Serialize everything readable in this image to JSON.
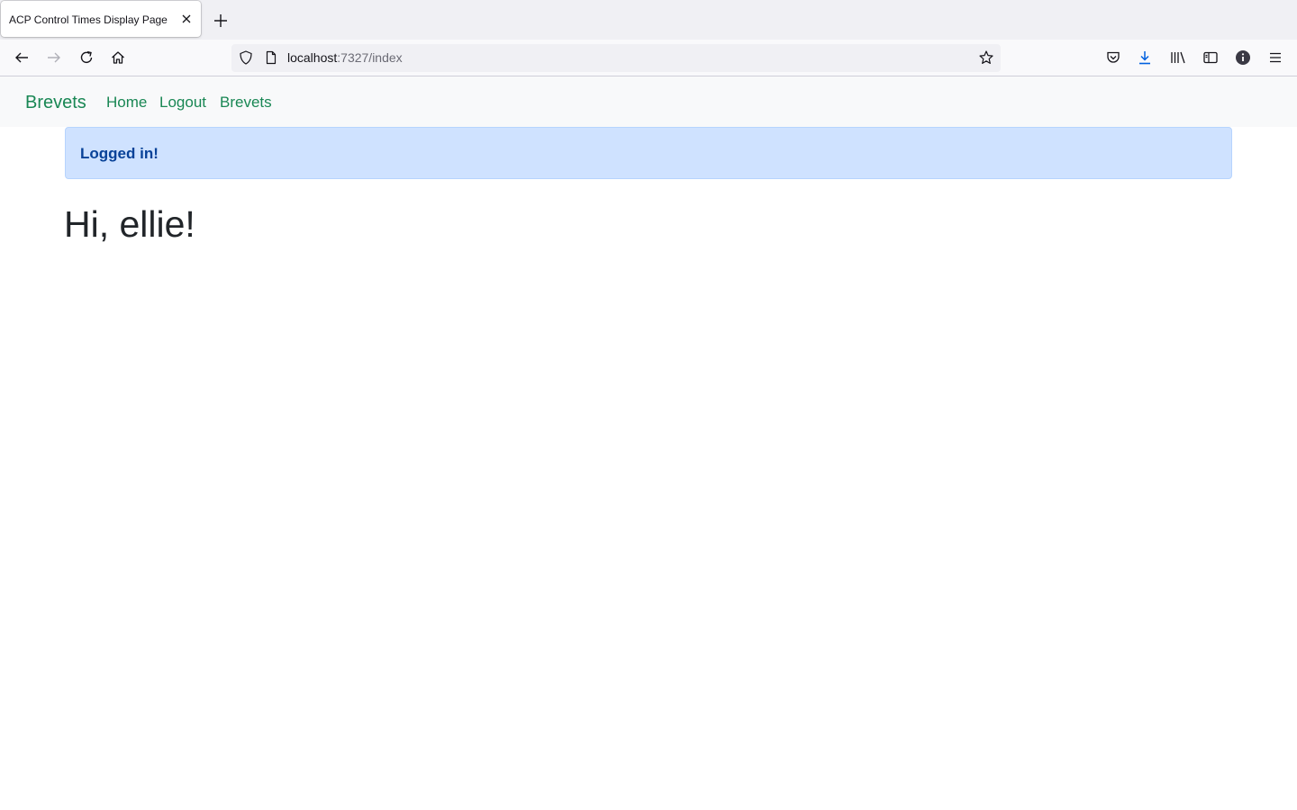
{
  "browser": {
    "tab_title": "ACP Control Times Display Page",
    "url_host": "localhost",
    "url_path": ":7327/index"
  },
  "navbar": {
    "brand": "Brevets",
    "links": [
      {
        "label": "Home"
      },
      {
        "label": "Logout"
      },
      {
        "label": "Brevets"
      }
    ]
  },
  "alert": {
    "message": "Logged in!"
  },
  "main": {
    "greeting": "Hi, ellie!"
  },
  "colors": {
    "link": "#198754",
    "alert_bg": "#cfe2ff",
    "alert_text": "#084298",
    "download_accent": "#0060df"
  },
  "icons": [
    "close-icon",
    "plus-icon",
    "back-arrow-icon",
    "forward-arrow-icon",
    "reload-icon",
    "home-icon",
    "shield-icon",
    "page-icon",
    "star-icon",
    "pocket-icon",
    "download-icon",
    "library-icon",
    "sidebar-icon",
    "info-icon",
    "hamburger-menu-icon"
  ]
}
